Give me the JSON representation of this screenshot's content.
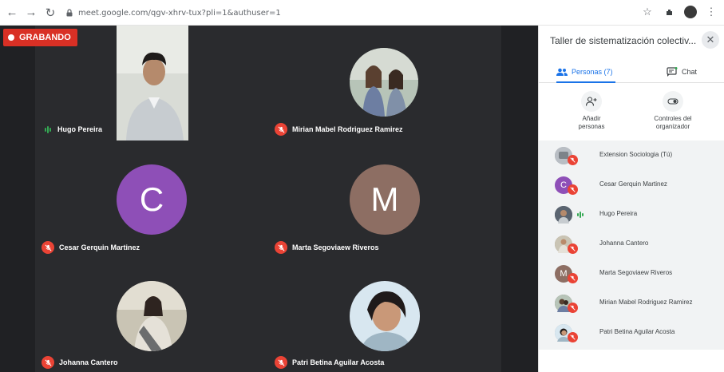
{
  "browser": {
    "url": "meet.google.com/qgv-xhrv-tux?pli=1&authuser=1"
  },
  "meeting": {
    "recording_label": "GRABANDO",
    "tiles": [
      {
        "name": "Hugo Pereira",
        "mic": "speaking"
      },
      {
        "name": "Mirian Mabel Rodriguez Ramirez",
        "mic": "muted"
      },
      {
        "name": "Cesar Gerquin Martinez",
        "mic": "muted",
        "initial": "C",
        "color": "#8e4fb7"
      },
      {
        "name": "Marta Segoviaew Riveros",
        "mic": "muted",
        "initial": "M",
        "color": "#8d6e63"
      },
      {
        "name": "Johanna Cantero",
        "mic": "muted"
      },
      {
        "name": "Patri Betina Aguilar Acosta",
        "mic": "muted"
      }
    ]
  },
  "panel": {
    "title": "Taller de sistematización colectiv...",
    "tabs": {
      "people": "Personas (7)",
      "chat": "Chat"
    },
    "actions": {
      "add_people": "Añadir personas",
      "host_controls": "Controles del organizador"
    },
    "people": [
      {
        "name": "Extension Sociologia (Tú)",
        "initial": "",
        "color": "#9aa0a6",
        "mic": "muted"
      },
      {
        "name": "Cesar Gerquin Martinez",
        "initial": "C",
        "color": "#8e4fb7",
        "mic": "muted"
      },
      {
        "name": "Hugo Pereira",
        "initial": "",
        "color": "#4a5560",
        "mic": "speaking"
      },
      {
        "name": "Johanna Cantero",
        "initial": "",
        "color": "#a08a70",
        "mic": "muted"
      },
      {
        "name": "Marta Segoviaew Riveros",
        "initial": "M",
        "color": "#8d6e63",
        "mic": "muted"
      },
      {
        "name": "Mirian Mabel Rodriguez Ramirez",
        "initial": "",
        "color": "#6b6258",
        "mic": "muted"
      },
      {
        "name": "Patri Betina Aguilar Acosta",
        "initial": "",
        "color": "#8a94a0",
        "mic": "muted"
      }
    ]
  },
  "colors": {
    "accent": "#1a73e8",
    "recording": "#d93025",
    "muted": "#ea4335",
    "speaking": "#34a853"
  }
}
